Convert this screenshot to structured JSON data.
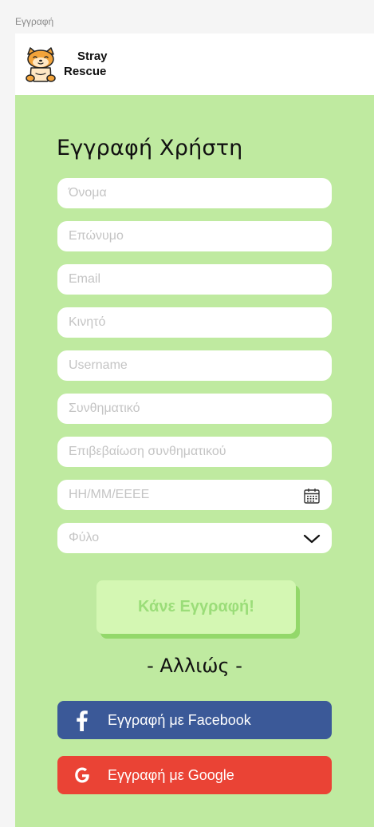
{
  "frame": {
    "label": "Εγγραφή"
  },
  "header": {
    "brand_line1": "Stray",
    "brand_line2": "Rescue",
    "logo_icon": "dog-logo-icon"
  },
  "form": {
    "title": "Εγγραφή Χρήστη",
    "fields": {
      "first_name": "Όνομα",
      "last_name": "Επώνυμο",
      "email": "Email",
      "mobile": "Κινητό",
      "username": "Username",
      "password": "Συνθηματικό",
      "confirm_password": "Επιβεβαίωση συνθηματικού",
      "birthdate": "ΗΗ/ΜΜ/ΕΕΕΕ",
      "gender": "Φύλο"
    },
    "submit_label": "Κάνε Εγγραφή!",
    "alt_text": "- Αλλιώς -"
  },
  "social": {
    "facebook_label": "Εγγραφή με Facebook",
    "google_label": "Εγγραφή με Google"
  },
  "colors": {
    "page_bg": "#bfeaa0",
    "submit_bg": "#d4f7b3",
    "submit_text": "#9bdd79",
    "facebook": "#3b5998",
    "google": "#ea4335"
  }
}
